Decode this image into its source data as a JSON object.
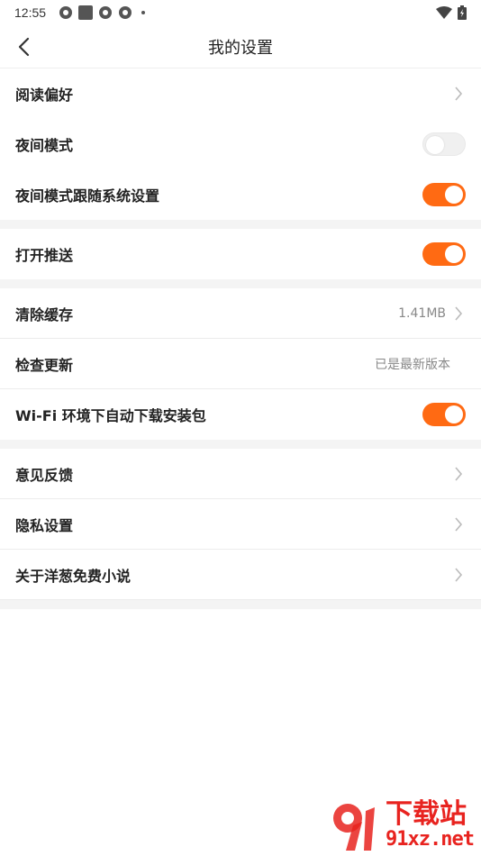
{
  "status_bar": {
    "time": "12:55"
  },
  "header": {
    "title": "我的设置"
  },
  "groups": [
    {
      "rows": [
        {
          "label": "阅读偏好",
          "type": "chevron"
        },
        {
          "label": "夜间模式",
          "type": "toggle",
          "on": false
        },
        {
          "label": "夜间模式跟随系统设置",
          "type": "toggle",
          "on": true
        }
      ]
    },
    {
      "rows": [
        {
          "label": "打开推送",
          "type": "toggle",
          "on": true
        }
      ]
    },
    {
      "rows": [
        {
          "label": "清除缓存",
          "type": "value-chevron",
          "value": "1.41MB"
        },
        {
          "label": "检查更新",
          "type": "value",
          "value": "已是最新版本"
        },
        {
          "label": "Wi-Fi 环境下自动下载安装包",
          "type": "toggle",
          "on": true
        }
      ]
    },
    {
      "rows": [
        {
          "label": "意见反馈",
          "type": "chevron"
        },
        {
          "label": "隐私设置",
          "type": "chevron"
        },
        {
          "label": "关于洋葱免费小说",
          "type": "chevron"
        }
      ]
    }
  ],
  "watermark": {
    "title": "下载站",
    "url": "91xz.net"
  },
  "colors": {
    "accent": "#ff6a13",
    "watermark": "#e8231f"
  }
}
